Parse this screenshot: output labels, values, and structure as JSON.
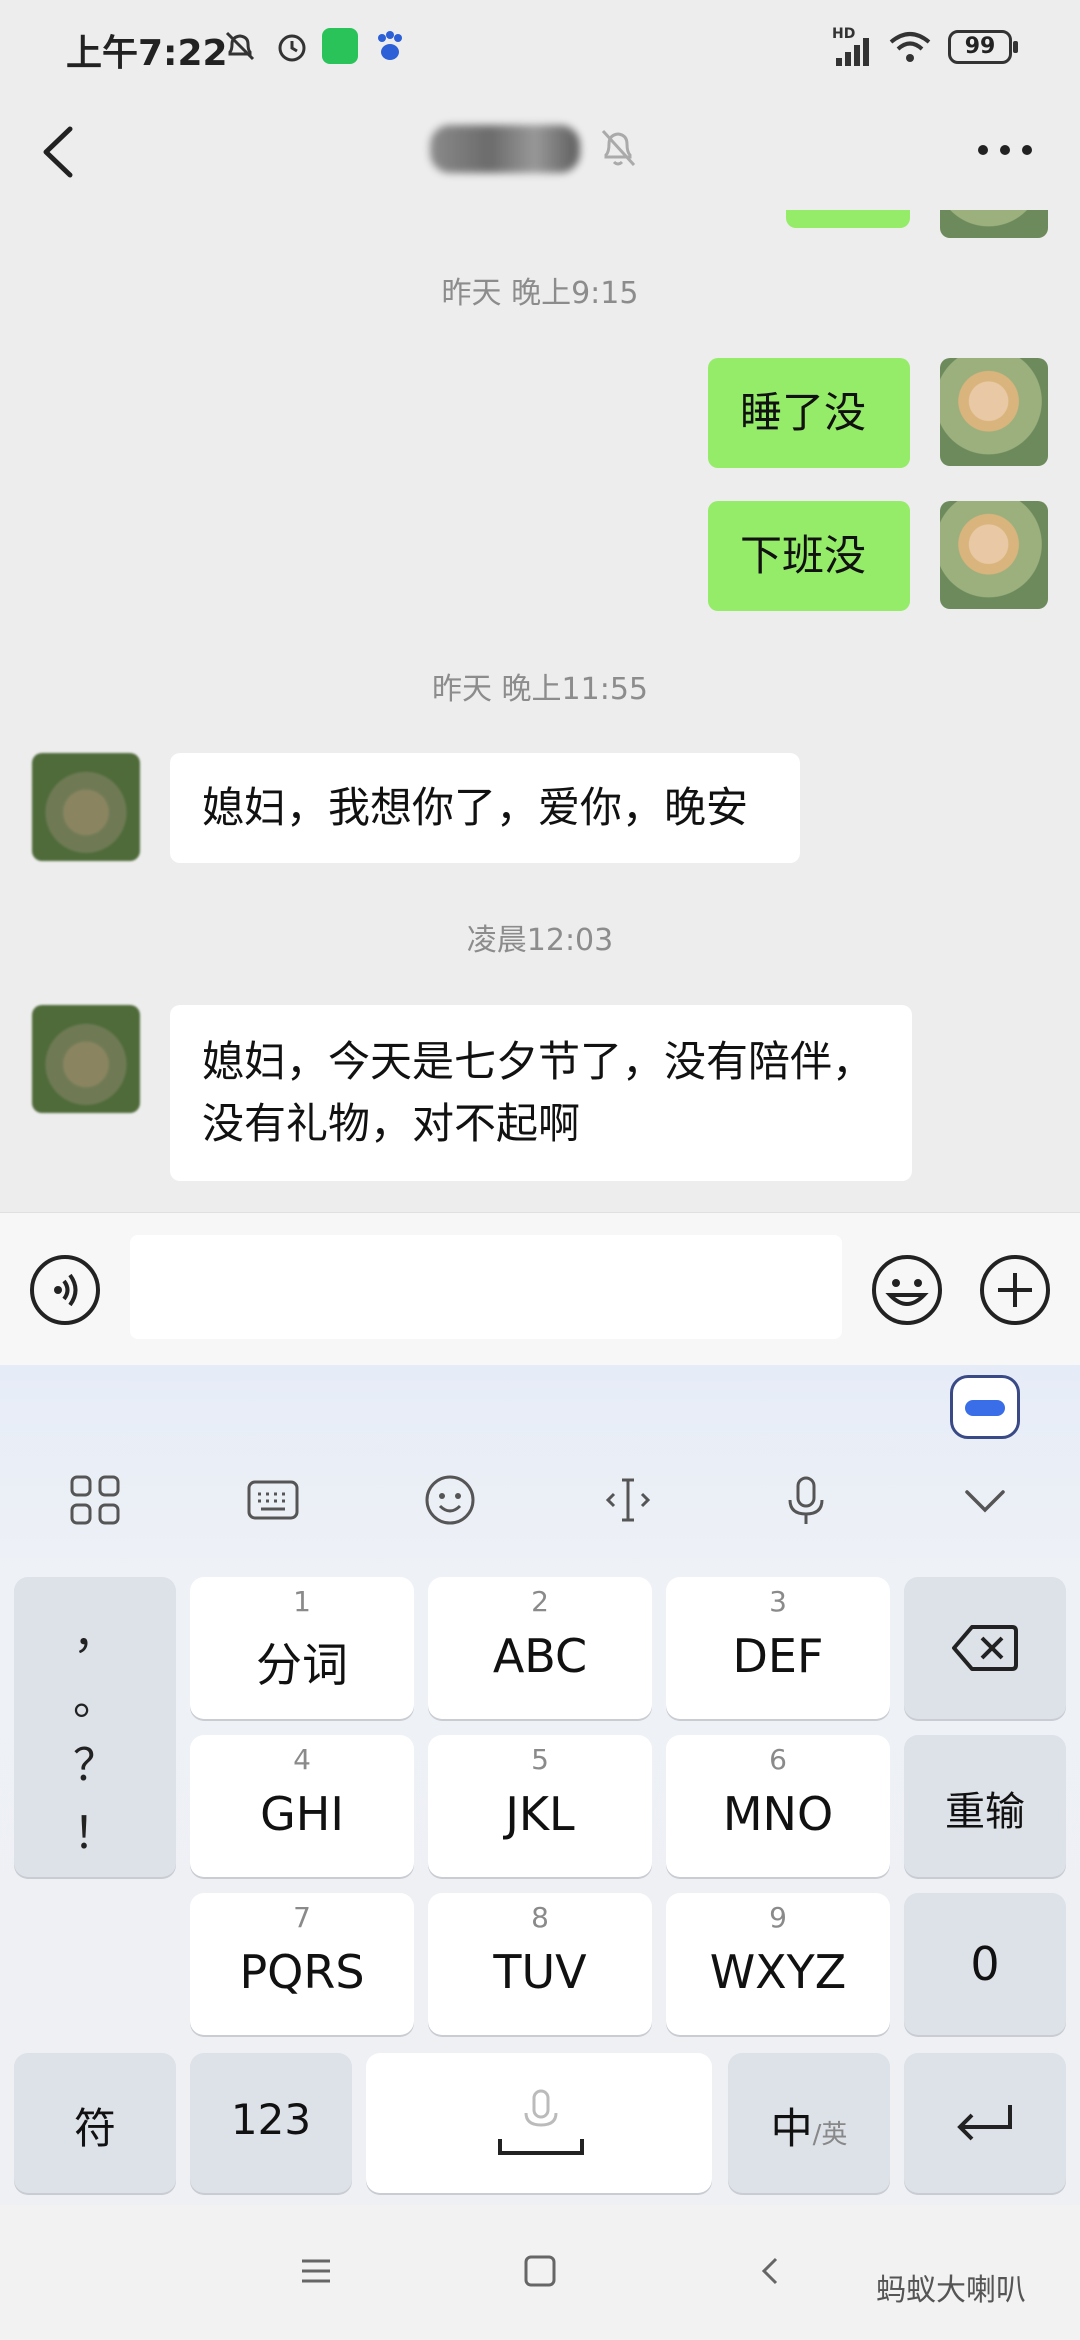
{
  "status_bar": {
    "time": "上午7:22",
    "battery": "99",
    "network": "HD",
    "icons": [
      "mute-notifications-icon",
      "alarm-icon",
      "app-notification-icon",
      "baidu-icon",
      "signal-icon",
      "wifi-icon",
      "battery-icon"
    ]
  },
  "header": {
    "back_icon": "chevron-left-icon",
    "contact_name": "",
    "mute_icon": "bell-muted-icon",
    "more_icon": "more-dots-icon"
  },
  "chat": {
    "messages": [
      {
        "type": "time",
        "text": "昨天 晚上9:15"
      },
      {
        "type": "sent",
        "text": "睡了没"
      },
      {
        "type": "sent",
        "text": "下班没"
      },
      {
        "type": "time",
        "text": "昨天 晚上11:55"
      },
      {
        "type": "received",
        "text": "媳妇，我想你了，爱你，晚安"
      },
      {
        "type": "time",
        "text": "凌晨12:03"
      },
      {
        "type": "received",
        "lines": [
          "媳妇，今天是七夕节了，没有陪伴，",
          "没有礼物，对不起啊"
        ]
      }
    ]
  },
  "input_bar": {
    "voice_icon": "voice-input-icon",
    "emoji_icon": "emoji-icon",
    "plus_icon": "plus-circle-icon",
    "value": ""
  },
  "keyboard": {
    "toolbar": [
      "apps-grid-icon",
      "keyboard-icon",
      "smiley-icon",
      "text-cursor-icon",
      "microphone-icon",
      "chevron-down-icon"
    ],
    "punctuation": [
      "，",
      "。",
      "？",
      "！"
    ],
    "keys": [
      {
        "num": "1",
        "label": "分词"
      },
      {
        "num": "2",
        "label": "ABC"
      },
      {
        "num": "3",
        "label": "DEF"
      },
      {
        "num": "4",
        "label": "GHI"
      },
      {
        "num": "5",
        "label": "JKL"
      },
      {
        "num": "6",
        "label": "MNO"
      },
      {
        "num": "7",
        "label": "PQRS"
      },
      {
        "num": "8",
        "label": "TUV"
      },
      {
        "num": "9",
        "label": "WXYZ"
      }
    ],
    "reinput": "重输",
    "zero": "0",
    "symbols": "符",
    "numbers": "123",
    "lang_main": "中",
    "lang_alt": "/英",
    "backspace_icon": "backspace-icon",
    "enter_icon": "enter-icon"
  },
  "nav_bar": {
    "icons": [
      "menu-icon",
      "home-square-icon",
      "back-triangle-icon"
    ],
    "watermark": "蚂蚁大喇叭"
  }
}
